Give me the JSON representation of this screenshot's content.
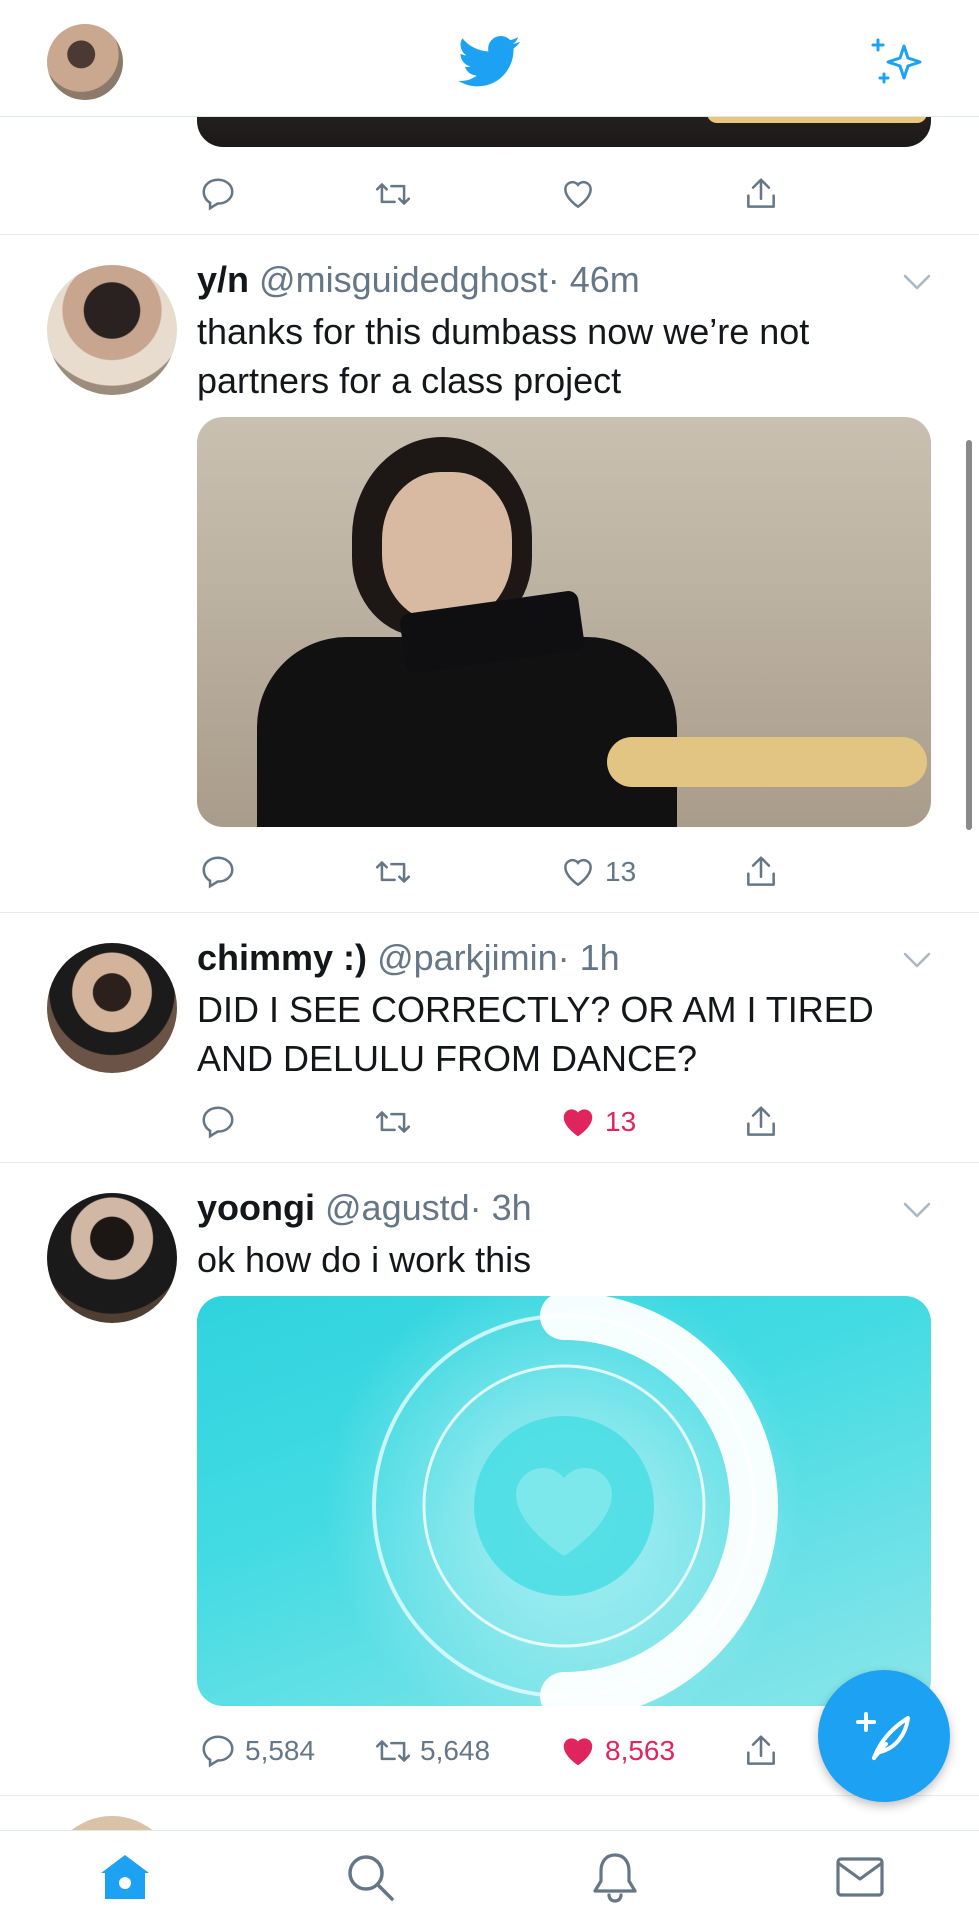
{
  "header": {
    "avatar_icon": "profile-avatar",
    "logo_icon": "twitter-bird-icon",
    "sparkle_icon": "sparkle-icon",
    "accent_color": "#1da1f2"
  },
  "tweets": [
    {
      "actions": {
        "reply": "",
        "retweet": "",
        "like": "",
        "share": ""
      }
    },
    {
      "name": "y/n",
      "handle": "@misguidedghost",
      "time": "· 46m",
      "text": "thanks for this dumbass now we’re not partners for a class project",
      "actions": {
        "reply": "",
        "retweet": "",
        "like": "13",
        "share": ""
      }
    },
    {
      "name": "chimmy :)",
      "handle": "@parkjimin",
      "time": "· 1h",
      "text": "DID I SEE CORRECTLY? OR AM I TIRED AND DELULU FROM DANCE?",
      "actions": {
        "reply": "",
        "retweet": "",
        "like": "13",
        "share": ""
      },
      "liked": true
    },
    {
      "name": "yoongi",
      "handle": "@agustd",
      "time": "· 3h",
      "text": "ok how do i work this",
      "actions": {
        "reply": "5,584",
        "retweet": "5,648",
        "like": "8,563",
        "share": ""
      },
      "liked": true
    }
  ],
  "nav": {
    "tabs": [
      "home-icon",
      "search-icon",
      "notifications-icon",
      "messages-icon"
    ]
  },
  "colors": {
    "like_red": "#e0245e",
    "text_gray": "#657786",
    "brand_blue": "#1da1f2"
  }
}
